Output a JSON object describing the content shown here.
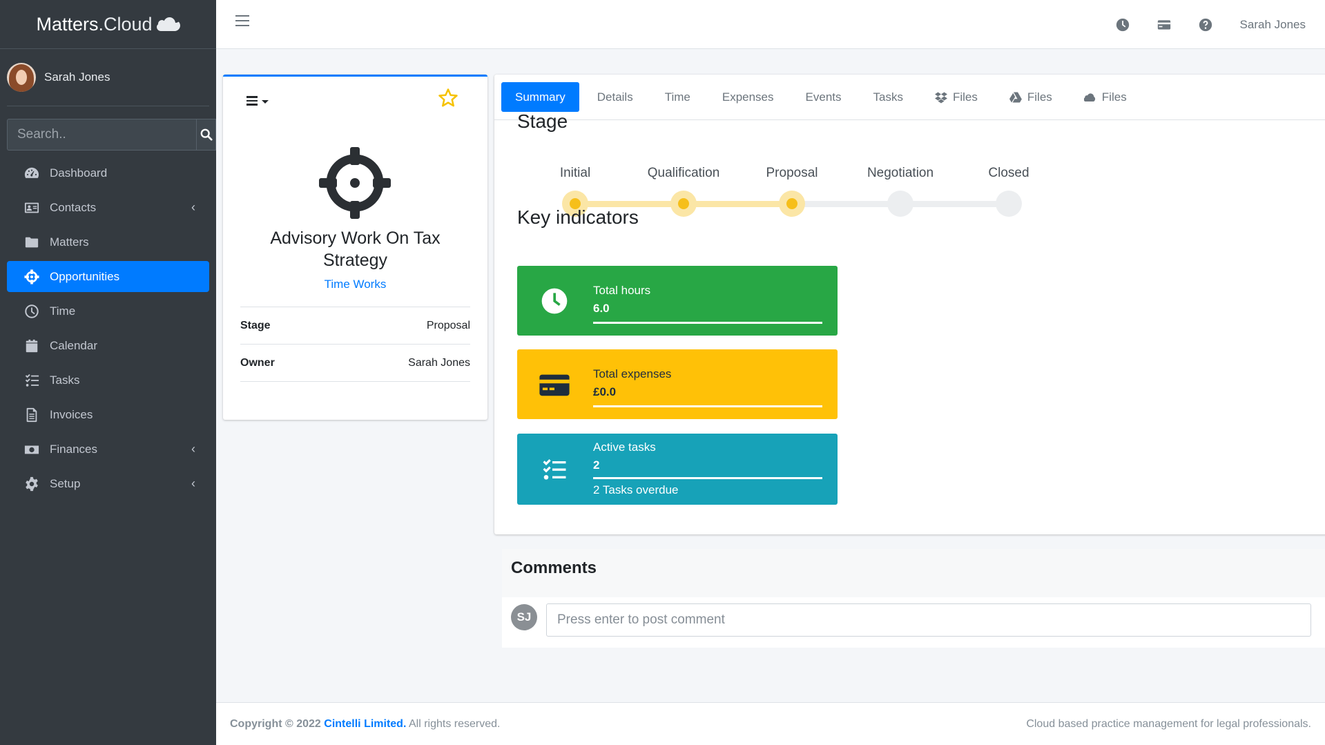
{
  "brand": {
    "name": "Matters",
    "suffix": ".Cloud",
    "icon": "cloud-icon"
  },
  "user": {
    "name": "Sarah Jones"
  },
  "search": {
    "placeholder": "Search.."
  },
  "sidebar": {
    "items": [
      {
        "label": "Dashboard",
        "icon": "tachometer-icon"
      },
      {
        "label": "Contacts",
        "icon": "address-card-icon",
        "expandable": true
      },
      {
        "label": "Matters",
        "icon": "folder-icon"
      },
      {
        "label": "Opportunities",
        "icon": "crosshairs-icon",
        "active": true
      },
      {
        "label": "Time",
        "icon": "clock-icon"
      },
      {
        "label": "Calendar",
        "icon": "calendar-icon"
      },
      {
        "label": "Tasks",
        "icon": "tasks-icon"
      },
      {
        "label": "Invoices",
        "icon": "invoice-icon"
      },
      {
        "label": "Finances",
        "icon": "money-bill-icon",
        "expandable": true
      },
      {
        "label": "Setup",
        "icon": "cog-icon",
        "expandable": true
      }
    ],
    "chevron": "‹"
  },
  "topbar": {
    "user": "Sarah Jones"
  },
  "opportunity": {
    "title": "Advisory Work On Tax Strategy",
    "client": "Time Works",
    "props": [
      {
        "key": "Stage",
        "value": "Proposal"
      },
      {
        "key": "Owner",
        "value": "Sarah Jones"
      }
    ]
  },
  "tabs": [
    {
      "label": "Summary",
      "active": true
    },
    {
      "label": "Details"
    },
    {
      "label": "Time"
    },
    {
      "label": "Expenses"
    },
    {
      "label": "Events"
    },
    {
      "label": "Tasks"
    },
    {
      "label": "Files",
      "icon": "dropbox-icon"
    },
    {
      "label": "Files",
      "icon": "google-drive-icon"
    },
    {
      "label": "Files",
      "icon": "cloud-icon"
    }
  ],
  "stage": {
    "title": "Stage",
    "steps": [
      "Initial",
      "Qualification",
      "Proposal",
      "Negotiation",
      "Closed"
    ],
    "current_index": 2
  },
  "indicators": {
    "title": "Key indicators",
    "items": [
      {
        "label": "Total hours",
        "value": "6.0",
        "color": "#28a745",
        "icon": "clock-icon"
      },
      {
        "label": "Total expenses",
        "value": "£0.0",
        "color": "#ffc107",
        "icon": "credit-card-icon"
      },
      {
        "label": "Active tasks",
        "value": "2",
        "sub": "2 Tasks overdue",
        "color": "#17a2b8",
        "icon": "tasks-icon"
      }
    ]
  },
  "comments": {
    "title": "Comments",
    "avatar": "SJ",
    "placeholder": "Press enter to post comment"
  },
  "footer": {
    "copyright": "Copyright © 2022",
    "company": "Cintelli Limited.",
    "rights": "All rights reserved.",
    "tagline": "Cloud based practice management for legal professionals."
  }
}
